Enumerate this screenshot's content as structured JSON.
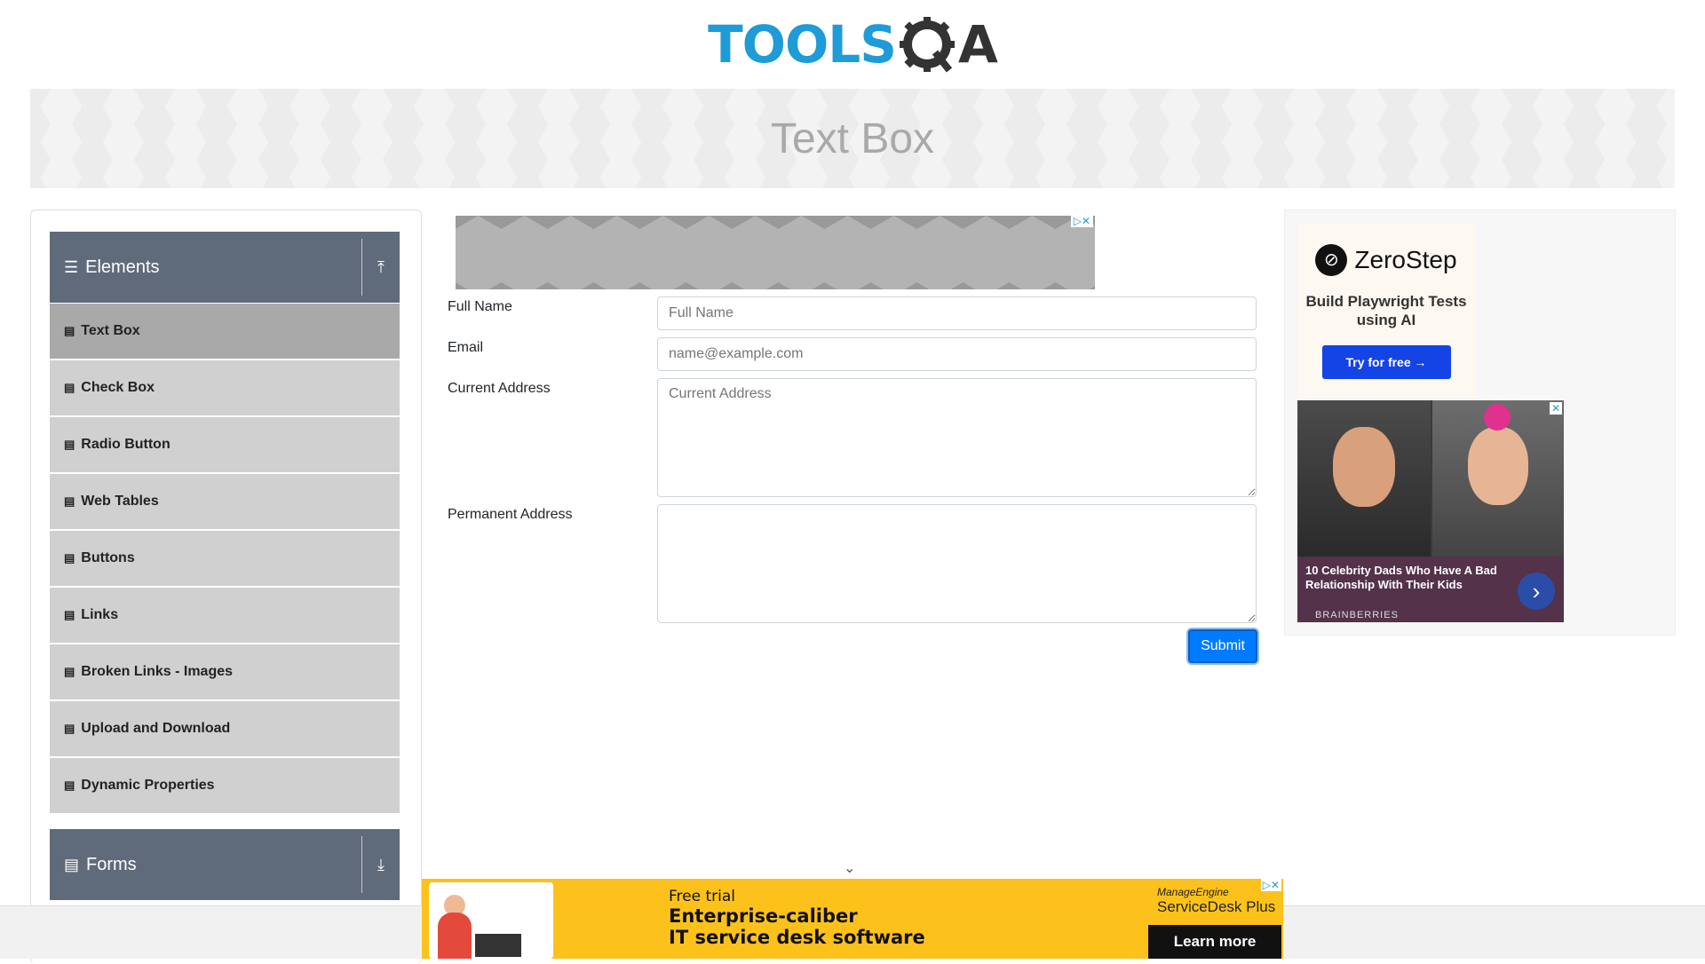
{
  "logo": {
    "part1": "TOOLS",
    "part2": "Q",
    "part3": "A"
  },
  "page_title": "Text Box",
  "sidebar": {
    "elements_group": {
      "label": "Elements",
      "icon": "hamburger-icon",
      "arrow": "collapse-up-icon"
    },
    "items": [
      {
        "label": "Text Box",
        "active": true
      },
      {
        "label": "Check Box"
      },
      {
        "label": "Radio Button"
      },
      {
        "label": "Web Tables"
      },
      {
        "label": "Buttons"
      },
      {
        "label": "Links"
      },
      {
        "label": "Broken Links - Images"
      },
      {
        "label": "Upload and Download"
      },
      {
        "label": "Dynamic Properties"
      }
    ],
    "forms_group": {
      "label": "Forms",
      "icon": "document-icon",
      "arrow": "expand-down-icon"
    }
  },
  "form": {
    "full_name": {
      "label": "Full Name",
      "placeholder": "Full Name",
      "value": ""
    },
    "email": {
      "label": "Email",
      "placeholder": "name@example.com",
      "value": ""
    },
    "current_address": {
      "label": "Current Address",
      "placeholder": "Current Address",
      "value": ""
    },
    "permanent_address": {
      "label": "Permanent Address",
      "placeholder": "",
      "value": ""
    },
    "submit_label": "Submit"
  },
  "right_ad": {
    "zerostep": {
      "brand": "ZeroStep",
      "tagline": "Build Playwright Tests using AI",
      "cta": "Try for free →"
    },
    "celebrity": {
      "headline": "10 Celebrity Dads Who Have A Bad Relationship With Their Kids",
      "source": "BRAINBERRIES"
    }
  },
  "bottom_ad": {
    "small": "Free trial",
    "line1": "Enterprise-caliber",
    "line2": "IT service desk software",
    "brand_top": "ManageEngine",
    "brand": "ServiceDesk Plus",
    "cta": "Learn more"
  },
  "colors": {
    "accent": "#007bff",
    "sidebar_header": "#5f6a7a",
    "menu_item": "#d0d0d0",
    "menu_active": "#a9a9a9",
    "ad_yellow": "#fcc21b"
  }
}
